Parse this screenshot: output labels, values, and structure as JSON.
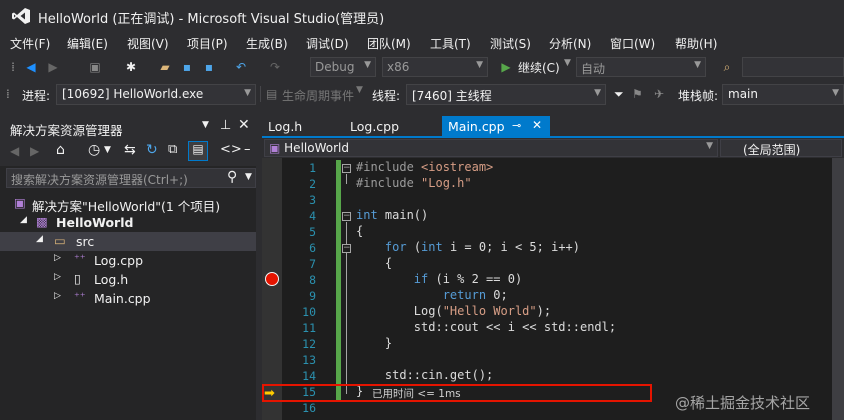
{
  "title": "HelloWorld (正在调试) - Microsoft Visual Studio(管理员)",
  "menu": [
    "文件(F)",
    "编辑(E)",
    "视图(V)",
    "项目(P)",
    "生成(B)",
    "调试(D)",
    "团队(M)",
    "工具(T)",
    "测试(S)",
    "分析(N)",
    "窗口(W)",
    "帮助(H)"
  ],
  "toolbar": {
    "config": "Debug",
    "platform": "x86",
    "continue_label": "继续(C)",
    "auto": "自动"
  },
  "debug": {
    "process_label": "进程:",
    "process_value": "[10692] HelloWorld.exe",
    "lifecycle_label": "生命周期事件",
    "thread_label": "线程:",
    "thread_value": "[7460] 主线程",
    "stack_label": "堆栈帧:",
    "stack_value": "main"
  },
  "solution_explorer": {
    "title": "解决方案资源管理器",
    "search_placeholder": "搜索解决方案资源管理器(Ctrl+;)",
    "solution": "解决方案\"HelloWorld\"(1 个项目)",
    "project": "HelloWorld",
    "folder": "src",
    "files": [
      "Log.cpp",
      "Log.h",
      "Main.cpp"
    ]
  },
  "tabs": [
    "Log.h",
    "Log.cpp",
    "Main.cpp"
  ],
  "nav": {
    "scope": "HelloWorld",
    "member": "(全局范围)"
  },
  "line_numbers": [
    "1",
    "2",
    "3",
    "4",
    "5",
    "6",
    "7",
    "8",
    "9",
    "10",
    "11",
    "12",
    "13",
    "14",
    "15",
    "16"
  ],
  "perf_tip": "已用时间 <= 1ms",
  "watermark": "@稀土掘金技术社区",
  "colors": {
    "accent": "#007acc",
    "breakpoint": "#e51400",
    "current_line": "#ffcc00",
    "change_bar": "#57a64a"
  }
}
